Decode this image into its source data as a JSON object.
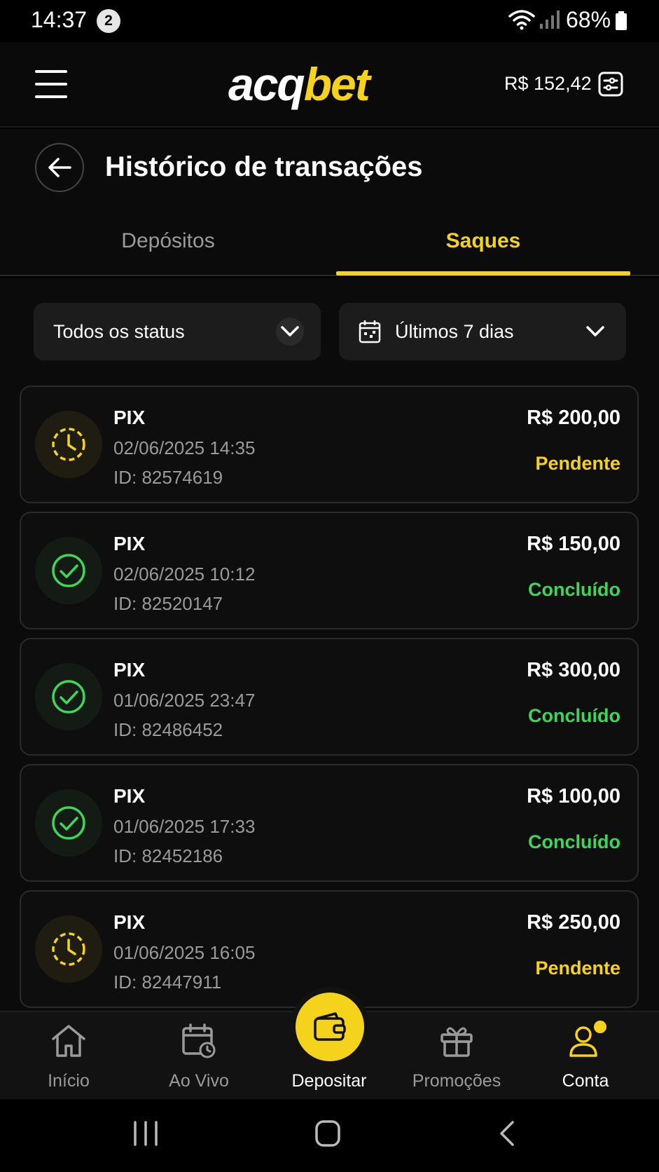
{
  "status_bar": {
    "time": "14:37",
    "notification_count": "2",
    "battery": "68%",
    "icons": [
      "wifi-icon",
      "signal-icon",
      "battery-icon"
    ]
  },
  "header": {
    "logo_part1": "acq",
    "logo_part2": "bet",
    "balance": "R$ 152,42"
  },
  "page": {
    "title": "Histórico de transações"
  },
  "tabs": {
    "deposits": "Depósitos",
    "withdrawals": "Saques",
    "active": "withdrawals"
  },
  "filters": {
    "status": "Todos os status",
    "period": "Últimos 7 dias"
  },
  "transactions": [
    {
      "method": "PIX",
      "date": "02/06/2025 14:35",
      "id": "ID: 82574619",
      "amount": "R$ 200,00",
      "status": "Pendente",
      "state": "pending"
    },
    {
      "method": "PIX",
      "date": "02/06/2025 10:12",
      "id": "ID: 82520147",
      "amount": "R$ 150,00",
      "status": "Concluído",
      "state": "done"
    },
    {
      "method": "PIX",
      "date": "01/06/2025 23:47",
      "id": "ID: 82486452",
      "amount": "R$ 300,00",
      "status": "Concluído",
      "state": "done"
    },
    {
      "method": "PIX",
      "date": "01/06/2025 17:33",
      "id": "ID: 82452186",
      "amount": "R$ 100,00",
      "status": "Concluído",
      "state": "done"
    },
    {
      "method": "PIX",
      "date": "01/06/2025 16:05",
      "id": "ID: 82447911",
      "amount": "R$ 250,00",
      "status": "Pendente",
      "state": "pending"
    }
  ],
  "bottom_nav": [
    {
      "label": "Início",
      "icon": "home-icon"
    },
    {
      "label": "Ao Vivo",
      "icon": "live-calendar-icon"
    },
    {
      "label": "Depositar",
      "icon": "wallet-icon"
    },
    {
      "label": "Promoções",
      "icon": "gift-icon"
    },
    {
      "label": "Conta",
      "icon": "user-icon"
    }
  ],
  "colors": {
    "accent": "#f5d31d",
    "success": "#3fd45a",
    "background": "#0b0b0b"
  }
}
